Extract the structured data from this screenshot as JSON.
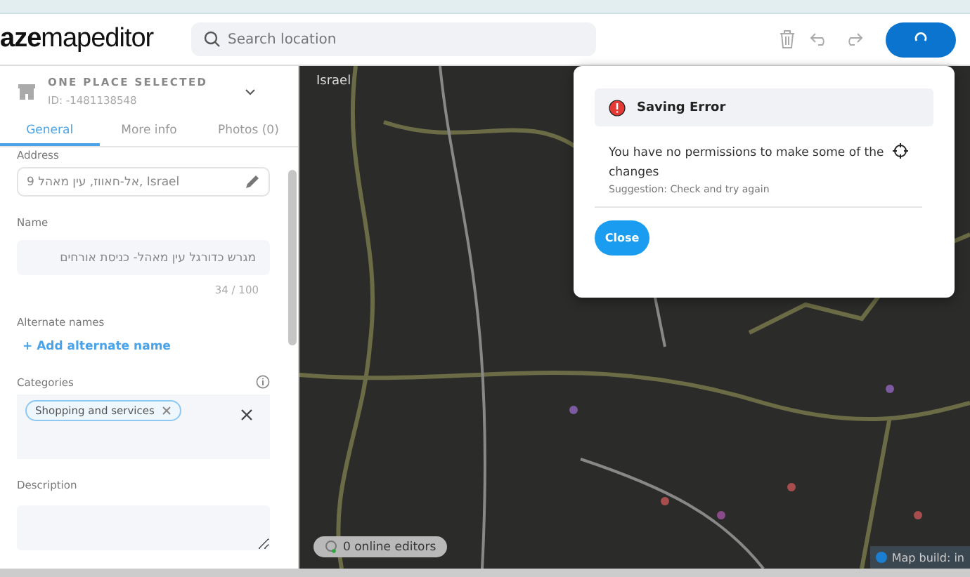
{
  "header": {
    "logo_bold": "aze",
    "logo_rest": "mapeditor",
    "search": {
      "placeholder": "Search location"
    }
  },
  "panel": {
    "title": "ONE PLACE SELECTED",
    "id": "ID: -1481138548",
    "tabs": [
      {
        "label": "General",
        "selected": true
      },
      {
        "label": "More info",
        "selected": false
      },
      {
        "label": "Photos (0)",
        "selected": false
      }
    ],
    "address": {
      "label": "Address",
      "value": "אל-חאווז, עין מאהל 9, Israel"
    },
    "name": {
      "label": "Name",
      "value": "מגרש כדורגל עין מאהל- כניסת אורחים",
      "counter": "34 / 100"
    },
    "alternate_names": {
      "label": "Alternate names",
      "link": "+ Add alternate name"
    },
    "categories": {
      "label": "Categories",
      "tags": [
        "Shopping and services"
      ]
    },
    "description": {
      "label": "Description"
    }
  },
  "map": {
    "region": "Israel",
    "online_editors": "0 online editors",
    "build": "Map build: in"
  },
  "dialog": {
    "title": "Saving Error",
    "message": "You have no permissions to make some of the changes",
    "suggestion": "Suggestion: Check and try again",
    "button": "Close"
  }
}
